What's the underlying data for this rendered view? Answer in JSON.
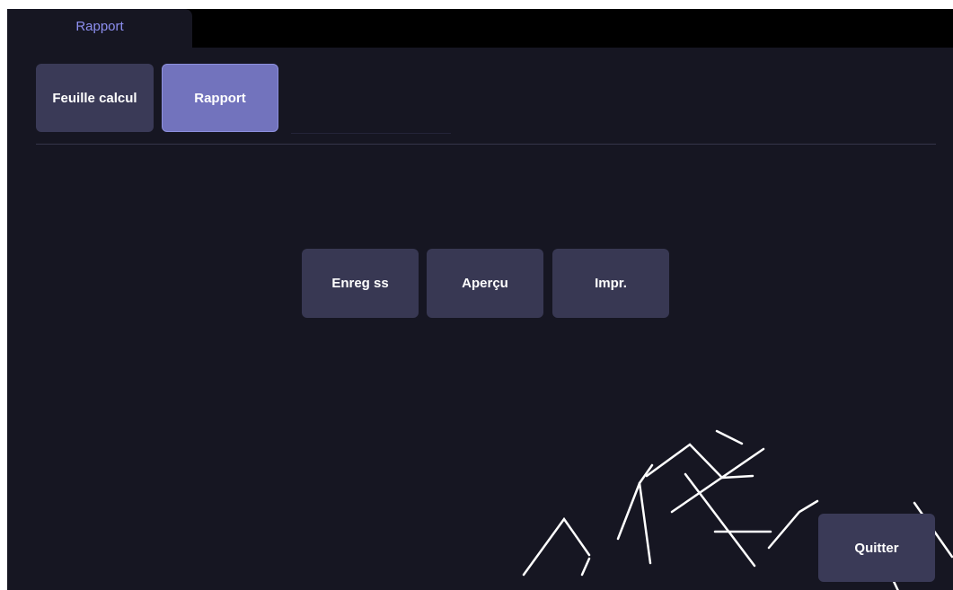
{
  "top_tabs": [
    {
      "label": "Rapport",
      "active": true
    }
  ],
  "sub_tabs": [
    {
      "label": "Feuille calcul",
      "active": false
    },
    {
      "label": "Rapport",
      "active": true
    }
  ],
  "actions": {
    "save_as": "Enreg ss",
    "preview": "Aperçu",
    "print": "Impr."
  },
  "quit_label": "Quitter",
  "colors": {
    "background": "#161622",
    "tab_bar": "#000000",
    "tab_text": "#8d8ff0",
    "button": "#383853",
    "button_active": "#7273bd",
    "text": "#ffffff"
  }
}
